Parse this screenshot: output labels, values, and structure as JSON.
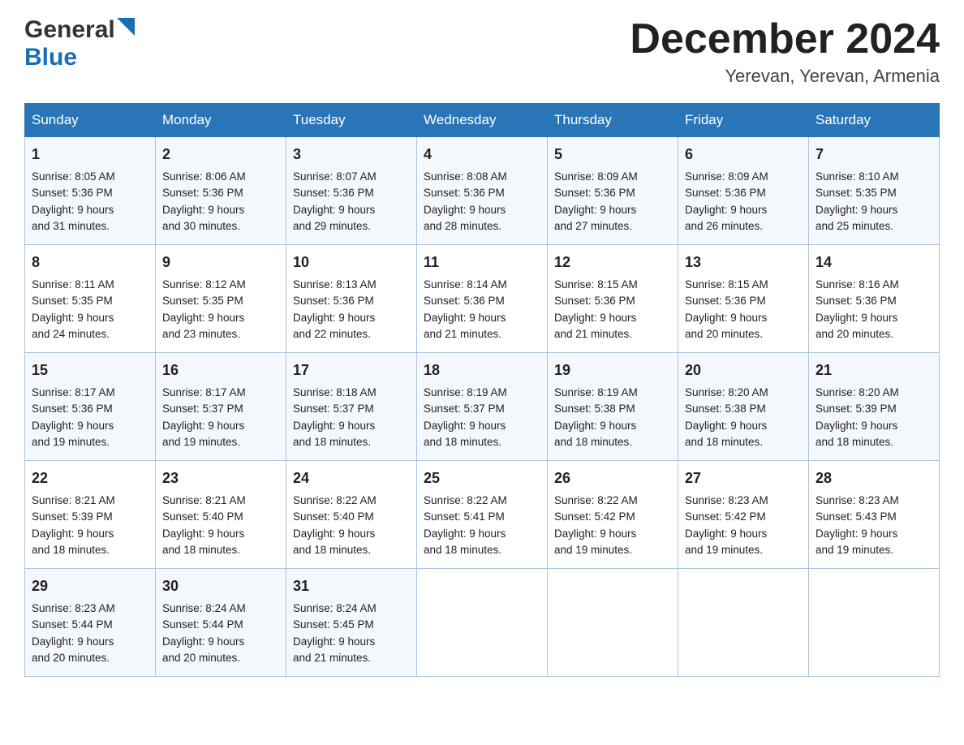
{
  "header": {
    "logo_general": "General",
    "logo_blue": "Blue",
    "month_year": "December 2024",
    "location": "Yerevan, Yerevan, Armenia"
  },
  "days_of_week": [
    "Sunday",
    "Monday",
    "Tuesday",
    "Wednesday",
    "Thursday",
    "Friday",
    "Saturday"
  ],
  "weeks": [
    [
      {
        "day": "1",
        "sunrise": "8:05 AM",
        "sunset": "5:36 PM",
        "daylight": "9 hours and 31 minutes."
      },
      {
        "day": "2",
        "sunrise": "8:06 AM",
        "sunset": "5:36 PM",
        "daylight": "9 hours and 30 minutes."
      },
      {
        "day": "3",
        "sunrise": "8:07 AM",
        "sunset": "5:36 PM",
        "daylight": "9 hours and 29 minutes."
      },
      {
        "day": "4",
        "sunrise": "8:08 AM",
        "sunset": "5:36 PM",
        "daylight": "9 hours and 28 minutes."
      },
      {
        "day": "5",
        "sunrise": "8:09 AM",
        "sunset": "5:36 PM",
        "daylight": "9 hours and 27 minutes."
      },
      {
        "day": "6",
        "sunrise": "8:09 AM",
        "sunset": "5:36 PM",
        "daylight": "9 hours and 26 minutes."
      },
      {
        "day": "7",
        "sunrise": "8:10 AM",
        "sunset": "5:35 PM",
        "daylight": "9 hours and 25 minutes."
      }
    ],
    [
      {
        "day": "8",
        "sunrise": "8:11 AM",
        "sunset": "5:35 PM",
        "daylight": "9 hours and 24 minutes."
      },
      {
        "day": "9",
        "sunrise": "8:12 AM",
        "sunset": "5:35 PM",
        "daylight": "9 hours and 23 minutes."
      },
      {
        "day": "10",
        "sunrise": "8:13 AM",
        "sunset": "5:36 PM",
        "daylight": "9 hours and 22 minutes."
      },
      {
        "day": "11",
        "sunrise": "8:14 AM",
        "sunset": "5:36 PM",
        "daylight": "9 hours and 21 minutes."
      },
      {
        "day": "12",
        "sunrise": "8:15 AM",
        "sunset": "5:36 PM",
        "daylight": "9 hours and 21 minutes."
      },
      {
        "day": "13",
        "sunrise": "8:15 AM",
        "sunset": "5:36 PM",
        "daylight": "9 hours and 20 minutes."
      },
      {
        "day": "14",
        "sunrise": "8:16 AM",
        "sunset": "5:36 PM",
        "daylight": "9 hours and 20 minutes."
      }
    ],
    [
      {
        "day": "15",
        "sunrise": "8:17 AM",
        "sunset": "5:36 PM",
        "daylight": "9 hours and 19 minutes."
      },
      {
        "day": "16",
        "sunrise": "8:17 AM",
        "sunset": "5:37 PM",
        "daylight": "9 hours and 19 minutes."
      },
      {
        "day": "17",
        "sunrise": "8:18 AM",
        "sunset": "5:37 PM",
        "daylight": "9 hours and 18 minutes."
      },
      {
        "day": "18",
        "sunrise": "8:19 AM",
        "sunset": "5:37 PM",
        "daylight": "9 hours and 18 minutes."
      },
      {
        "day": "19",
        "sunrise": "8:19 AM",
        "sunset": "5:38 PM",
        "daylight": "9 hours and 18 minutes."
      },
      {
        "day": "20",
        "sunrise": "8:20 AM",
        "sunset": "5:38 PM",
        "daylight": "9 hours and 18 minutes."
      },
      {
        "day": "21",
        "sunrise": "8:20 AM",
        "sunset": "5:39 PM",
        "daylight": "9 hours and 18 minutes."
      }
    ],
    [
      {
        "day": "22",
        "sunrise": "8:21 AM",
        "sunset": "5:39 PM",
        "daylight": "9 hours and 18 minutes."
      },
      {
        "day": "23",
        "sunrise": "8:21 AM",
        "sunset": "5:40 PM",
        "daylight": "9 hours and 18 minutes."
      },
      {
        "day": "24",
        "sunrise": "8:22 AM",
        "sunset": "5:40 PM",
        "daylight": "9 hours and 18 minutes."
      },
      {
        "day": "25",
        "sunrise": "8:22 AM",
        "sunset": "5:41 PM",
        "daylight": "9 hours and 18 minutes."
      },
      {
        "day": "26",
        "sunrise": "8:22 AM",
        "sunset": "5:42 PM",
        "daylight": "9 hours and 19 minutes."
      },
      {
        "day": "27",
        "sunrise": "8:23 AM",
        "sunset": "5:42 PM",
        "daylight": "9 hours and 19 minutes."
      },
      {
        "day": "28",
        "sunrise": "8:23 AM",
        "sunset": "5:43 PM",
        "daylight": "9 hours and 19 minutes."
      }
    ],
    [
      {
        "day": "29",
        "sunrise": "8:23 AM",
        "sunset": "5:44 PM",
        "daylight": "9 hours and 20 minutes."
      },
      {
        "day": "30",
        "sunrise": "8:24 AM",
        "sunset": "5:44 PM",
        "daylight": "9 hours and 20 minutes."
      },
      {
        "day": "31",
        "sunrise": "8:24 AM",
        "sunset": "5:45 PM",
        "daylight": "9 hours and 21 minutes."
      },
      null,
      null,
      null,
      null
    ]
  ],
  "labels": {
    "sunrise": "Sunrise:",
    "sunset": "Sunset:",
    "daylight": "Daylight:"
  }
}
